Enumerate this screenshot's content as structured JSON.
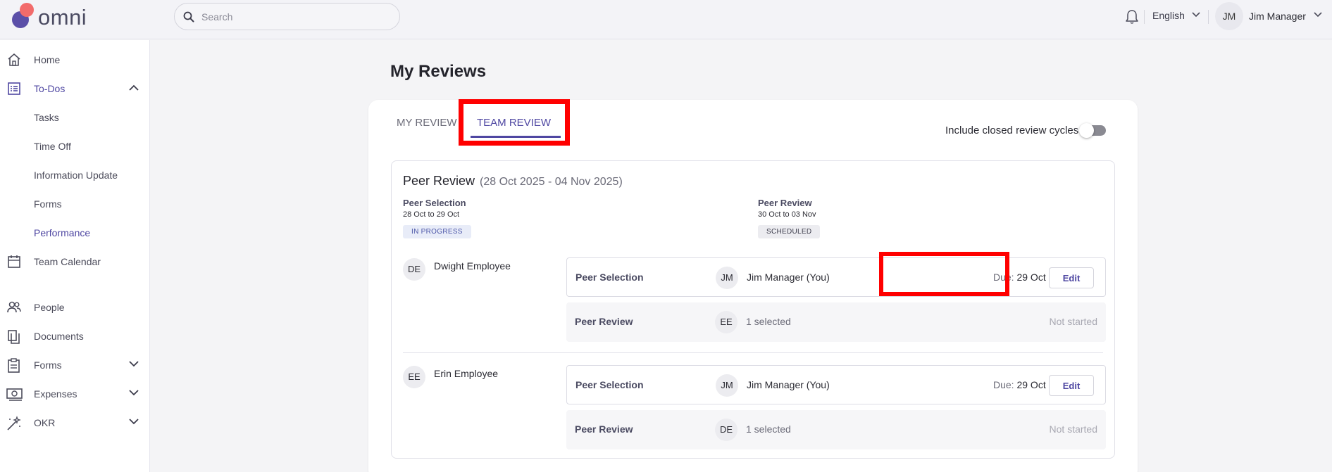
{
  "app": {
    "logo_text": "omni",
    "search_placeholder": "Search",
    "language": "English",
    "user_initials": "JM",
    "user_name": "Jim Manager"
  },
  "colors": {
    "accent": "#4f47a2",
    "logo_purple": "#5b4fa8",
    "logo_coral": "#f26b6b",
    "highlight": "#ff0000"
  },
  "sidebar": {
    "items": [
      {
        "label": "Home",
        "icon": "home-icon"
      },
      {
        "label": "To-Dos",
        "icon": "checklist-icon",
        "expanded": true
      },
      {
        "label": "Tasks"
      },
      {
        "label": "Time Off"
      },
      {
        "label": "Information Update"
      },
      {
        "label": "Forms"
      },
      {
        "label": "Performance"
      },
      {
        "label": "Team Calendar",
        "icon": "calendar-icon"
      },
      {
        "label": "People",
        "icon": "people-icon"
      },
      {
        "label": "Documents",
        "icon": "documents-icon"
      },
      {
        "label": "Forms",
        "icon": "form-icon"
      },
      {
        "label": "Expenses",
        "icon": "money-icon"
      },
      {
        "label": "OKR",
        "icon": "wand-icon"
      }
    ]
  },
  "main": {
    "title": "My Reviews",
    "tabs": [
      {
        "label": "MY REVIEW",
        "active": false
      },
      {
        "label": "TEAM REVIEW",
        "active": true
      }
    ],
    "toggle_label": "Include closed review cycles",
    "toggle_on": false,
    "cycle": {
      "name": "Peer Review",
      "dates": "(28 Oct 2025 - 04 Nov 2025)",
      "phases": [
        {
          "name": "Peer Selection",
          "range": "28 Oct to 29 Oct",
          "status": "IN PROGRESS"
        },
        {
          "name": "Peer Review",
          "range": "30 Oct to 03 Nov",
          "status": "SCHEDULED"
        }
      ],
      "employees": [
        {
          "initials": "DE",
          "name": "Dwight Employee",
          "selection": {
            "label": "Peer Selection",
            "reviewer_initials": "JM",
            "reviewer": "Jim Manager (You)",
            "due_key": "Due:",
            "due": "29 Oct",
            "action": "Edit"
          },
          "review": {
            "label": "Peer Review",
            "reviewer_initials": "EE",
            "reviewer": "1 selected",
            "status": "Not started"
          }
        },
        {
          "initials": "EE",
          "name": "Erin Employee",
          "selection": {
            "label": "Peer Selection",
            "reviewer_initials": "JM",
            "reviewer": "Jim Manager (You)",
            "due_key": "Due:",
            "due": "29 Oct",
            "action": "Edit"
          },
          "review": {
            "label": "Peer Review",
            "reviewer_initials": "DE",
            "reviewer": "1 selected",
            "status": "Not started"
          }
        }
      ]
    }
  }
}
